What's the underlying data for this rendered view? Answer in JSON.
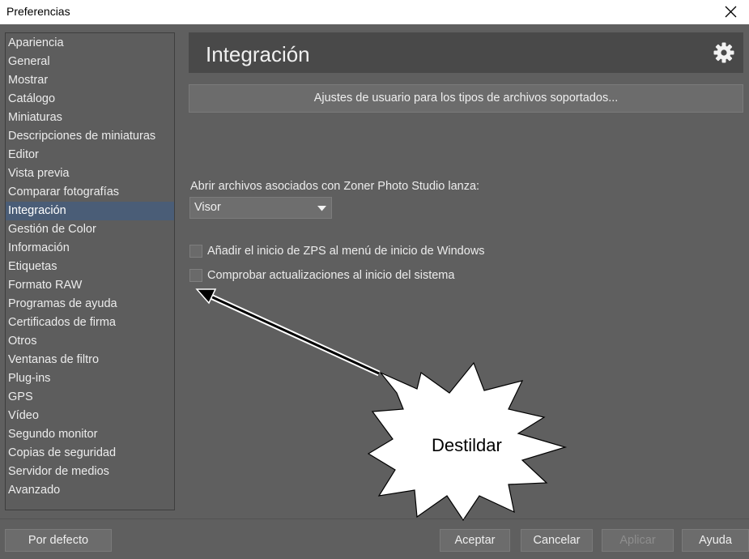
{
  "window": {
    "title": "Preferencias"
  },
  "sidebar": {
    "items": [
      {
        "label": "Apariencia"
      },
      {
        "label": "General"
      },
      {
        "label": "Mostrar"
      },
      {
        "label": "Catálogo"
      },
      {
        "label": "Miniaturas"
      },
      {
        "label": "Descripciones de miniaturas"
      },
      {
        "label": "Editor"
      },
      {
        "label": "Vista previa"
      },
      {
        "label": "Comparar fotografías"
      },
      {
        "label": "Integración",
        "selected": true
      },
      {
        "label": "Gestión de Color"
      },
      {
        "label": "Información"
      },
      {
        "label": "Etiquetas"
      },
      {
        "label": "Formato RAW"
      },
      {
        "label": "Programas de ayuda"
      },
      {
        "label": "Certificados de firma"
      },
      {
        "label": "Otros"
      },
      {
        "label": "Ventanas de filtro"
      },
      {
        "label": "Plug-ins"
      },
      {
        "label": "GPS"
      },
      {
        "label": "Vídeo"
      },
      {
        "label": "Segundo monitor"
      },
      {
        "label": "Copias de seguridad"
      },
      {
        "label": "Servidor de medios"
      },
      {
        "label": "Avanzado"
      }
    ]
  },
  "main": {
    "title": "Integración",
    "filetypes_button": "Ajustes de usuario para los tipos de archivos soportados...",
    "open_label": "Abrir archivos asociados con Zoner Photo Studio lanza:",
    "open_select": "Visor",
    "checkboxes": [
      {
        "label": "Añadir el inicio de ZPS al menú de inicio de Windows",
        "checked": false
      },
      {
        "label": "Comprobar actualizaciones al inicio del sistema",
        "checked": false
      }
    ]
  },
  "annotation": {
    "text": "Destildar"
  },
  "footer": {
    "default_button": "Por defecto",
    "accept_button": "Aceptar",
    "cancel_button": "Cancelar",
    "apply_button": "Aplicar",
    "help_button": "Ayuda"
  },
  "colors": {
    "selected_item_bg": "#4a5d77",
    "panel_bg": "#5f5f5f",
    "header_bg": "#494949"
  }
}
